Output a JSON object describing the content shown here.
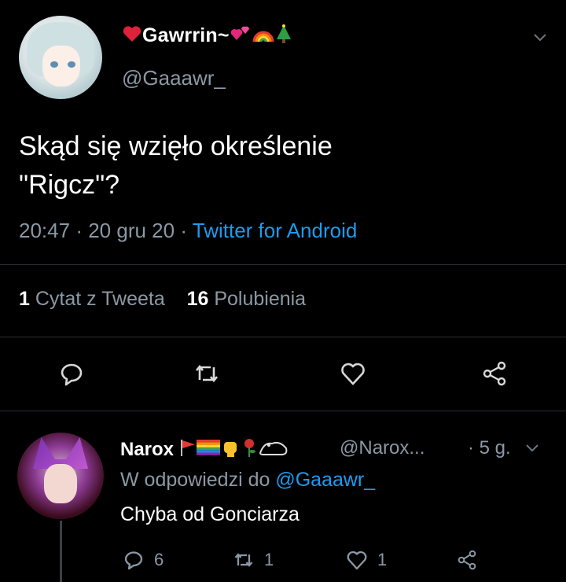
{
  "tweet": {
    "display_name": "Gawrrin~",
    "handle": "@Gaaawr_",
    "text_line1": "Skąd się wzięło określenie",
    "text_line2": "\"Rigcz\"?",
    "time": "20:47",
    "date": "20 gru 20",
    "source": "Twitter for Android",
    "sep": "·",
    "quote_count": "1",
    "quote_label": "Cytat z Tweeta",
    "like_count": "16",
    "like_label": "Polubienia",
    "actions": [
      "reply-icon",
      "retweet-icon",
      "like-icon",
      "share-icon"
    ]
  },
  "reply": {
    "display_name": "Narox",
    "handle": "@Narox...",
    "time": "· 5 g.",
    "reply_prefix": "W odpowiedzi do",
    "reply_mention": "@Gaaawr_",
    "text": "Chyba od Gonciarza",
    "reply_count": "6",
    "retweet_count": "1",
    "like_count": "1"
  },
  "colors": {
    "background": "#000000",
    "text": "#ffffff",
    "secondary": "#8b98a5",
    "link": "#1d9bf0",
    "divider": "#2a2f33"
  }
}
